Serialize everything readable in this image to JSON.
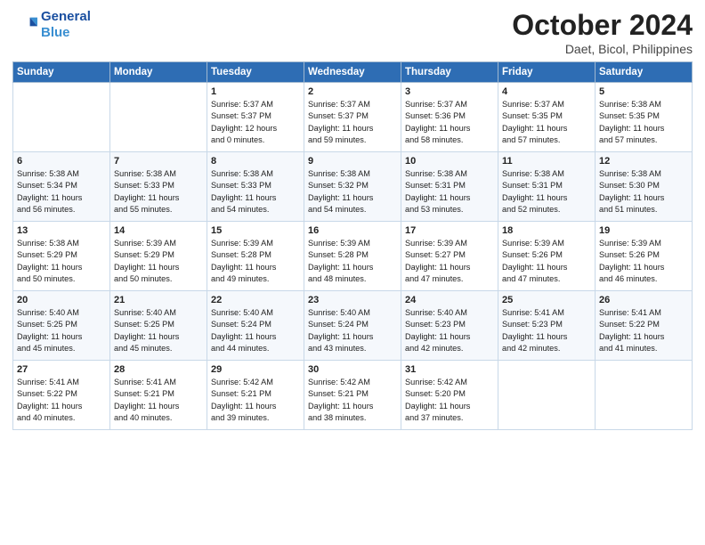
{
  "header": {
    "logo_line1": "General",
    "logo_line2": "Blue",
    "title": "October 2024",
    "subtitle": "Daet, Bicol, Philippines"
  },
  "columns": [
    "Sunday",
    "Monday",
    "Tuesday",
    "Wednesday",
    "Thursday",
    "Friday",
    "Saturday"
  ],
  "weeks": [
    [
      {
        "day": "",
        "info": ""
      },
      {
        "day": "",
        "info": ""
      },
      {
        "day": "1",
        "info": "Sunrise: 5:37 AM\nSunset: 5:37 PM\nDaylight: 12 hours\nand 0 minutes."
      },
      {
        "day": "2",
        "info": "Sunrise: 5:37 AM\nSunset: 5:37 PM\nDaylight: 11 hours\nand 59 minutes."
      },
      {
        "day": "3",
        "info": "Sunrise: 5:37 AM\nSunset: 5:36 PM\nDaylight: 11 hours\nand 58 minutes."
      },
      {
        "day": "4",
        "info": "Sunrise: 5:37 AM\nSunset: 5:35 PM\nDaylight: 11 hours\nand 57 minutes."
      },
      {
        "day": "5",
        "info": "Sunrise: 5:38 AM\nSunset: 5:35 PM\nDaylight: 11 hours\nand 57 minutes."
      }
    ],
    [
      {
        "day": "6",
        "info": "Sunrise: 5:38 AM\nSunset: 5:34 PM\nDaylight: 11 hours\nand 56 minutes."
      },
      {
        "day": "7",
        "info": "Sunrise: 5:38 AM\nSunset: 5:33 PM\nDaylight: 11 hours\nand 55 minutes."
      },
      {
        "day": "8",
        "info": "Sunrise: 5:38 AM\nSunset: 5:33 PM\nDaylight: 11 hours\nand 54 minutes."
      },
      {
        "day": "9",
        "info": "Sunrise: 5:38 AM\nSunset: 5:32 PM\nDaylight: 11 hours\nand 54 minutes."
      },
      {
        "day": "10",
        "info": "Sunrise: 5:38 AM\nSunset: 5:31 PM\nDaylight: 11 hours\nand 53 minutes."
      },
      {
        "day": "11",
        "info": "Sunrise: 5:38 AM\nSunset: 5:31 PM\nDaylight: 11 hours\nand 52 minutes."
      },
      {
        "day": "12",
        "info": "Sunrise: 5:38 AM\nSunset: 5:30 PM\nDaylight: 11 hours\nand 51 minutes."
      }
    ],
    [
      {
        "day": "13",
        "info": "Sunrise: 5:38 AM\nSunset: 5:29 PM\nDaylight: 11 hours\nand 50 minutes."
      },
      {
        "day": "14",
        "info": "Sunrise: 5:39 AM\nSunset: 5:29 PM\nDaylight: 11 hours\nand 50 minutes."
      },
      {
        "day": "15",
        "info": "Sunrise: 5:39 AM\nSunset: 5:28 PM\nDaylight: 11 hours\nand 49 minutes."
      },
      {
        "day": "16",
        "info": "Sunrise: 5:39 AM\nSunset: 5:28 PM\nDaylight: 11 hours\nand 48 minutes."
      },
      {
        "day": "17",
        "info": "Sunrise: 5:39 AM\nSunset: 5:27 PM\nDaylight: 11 hours\nand 47 minutes."
      },
      {
        "day": "18",
        "info": "Sunrise: 5:39 AM\nSunset: 5:26 PM\nDaylight: 11 hours\nand 47 minutes."
      },
      {
        "day": "19",
        "info": "Sunrise: 5:39 AM\nSunset: 5:26 PM\nDaylight: 11 hours\nand 46 minutes."
      }
    ],
    [
      {
        "day": "20",
        "info": "Sunrise: 5:40 AM\nSunset: 5:25 PM\nDaylight: 11 hours\nand 45 minutes."
      },
      {
        "day": "21",
        "info": "Sunrise: 5:40 AM\nSunset: 5:25 PM\nDaylight: 11 hours\nand 45 minutes."
      },
      {
        "day": "22",
        "info": "Sunrise: 5:40 AM\nSunset: 5:24 PM\nDaylight: 11 hours\nand 44 minutes."
      },
      {
        "day": "23",
        "info": "Sunrise: 5:40 AM\nSunset: 5:24 PM\nDaylight: 11 hours\nand 43 minutes."
      },
      {
        "day": "24",
        "info": "Sunrise: 5:40 AM\nSunset: 5:23 PM\nDaylight: 11 hours\nand 42 minutes."
      },
      {
        "day": "25",
        "info": "Sunrise: 5:41 AM\nSunset: 5:23 PM\nDaylight: 11 hours\nand 42 minutes."
      },
      {
        "day": "26",
        "info": "Sunrise: 5:41 AM\nSunset: 5:22 PM\nDaylight: 11 hours\nand 41 minutes."
      }
    ],
    [
      {
        "day": "27",
        "info": "Sunrise: 5:41 AM\nSunset: 5:22 PM\nDaylight: 11 hours\nand 40 minutes."
      },
      {
        "day": "28",
        "info": "Sunrise: 5:41 AM\nSunset: 5:21 PM\nDaylight: 11 hours\nand 40 minutes."
      },
      {
        "day": "29",
        "info": "Sunrise: 5:42 AM\nSunset: 5:21 PM\nDaylight: 11 hours\nand 39 minutes."
      },
      {
        "day": "30",
        "info": "Sunrise: 5:42 AM\nSunset: 5:21 PM\nDaylight: 11 hours\nand 38 minutes."
      },
      {
        "day": "31",
        "info": "Sunrise: 5:42 AM\nSunset: 5:20 PM\nDaylight: 11 hours\nand 37 minutes."
      },
      {
        "day": "",
        "info": ""
      },
      {
        "day": "",
        "info": ""
      }
    ]
  ]
}
